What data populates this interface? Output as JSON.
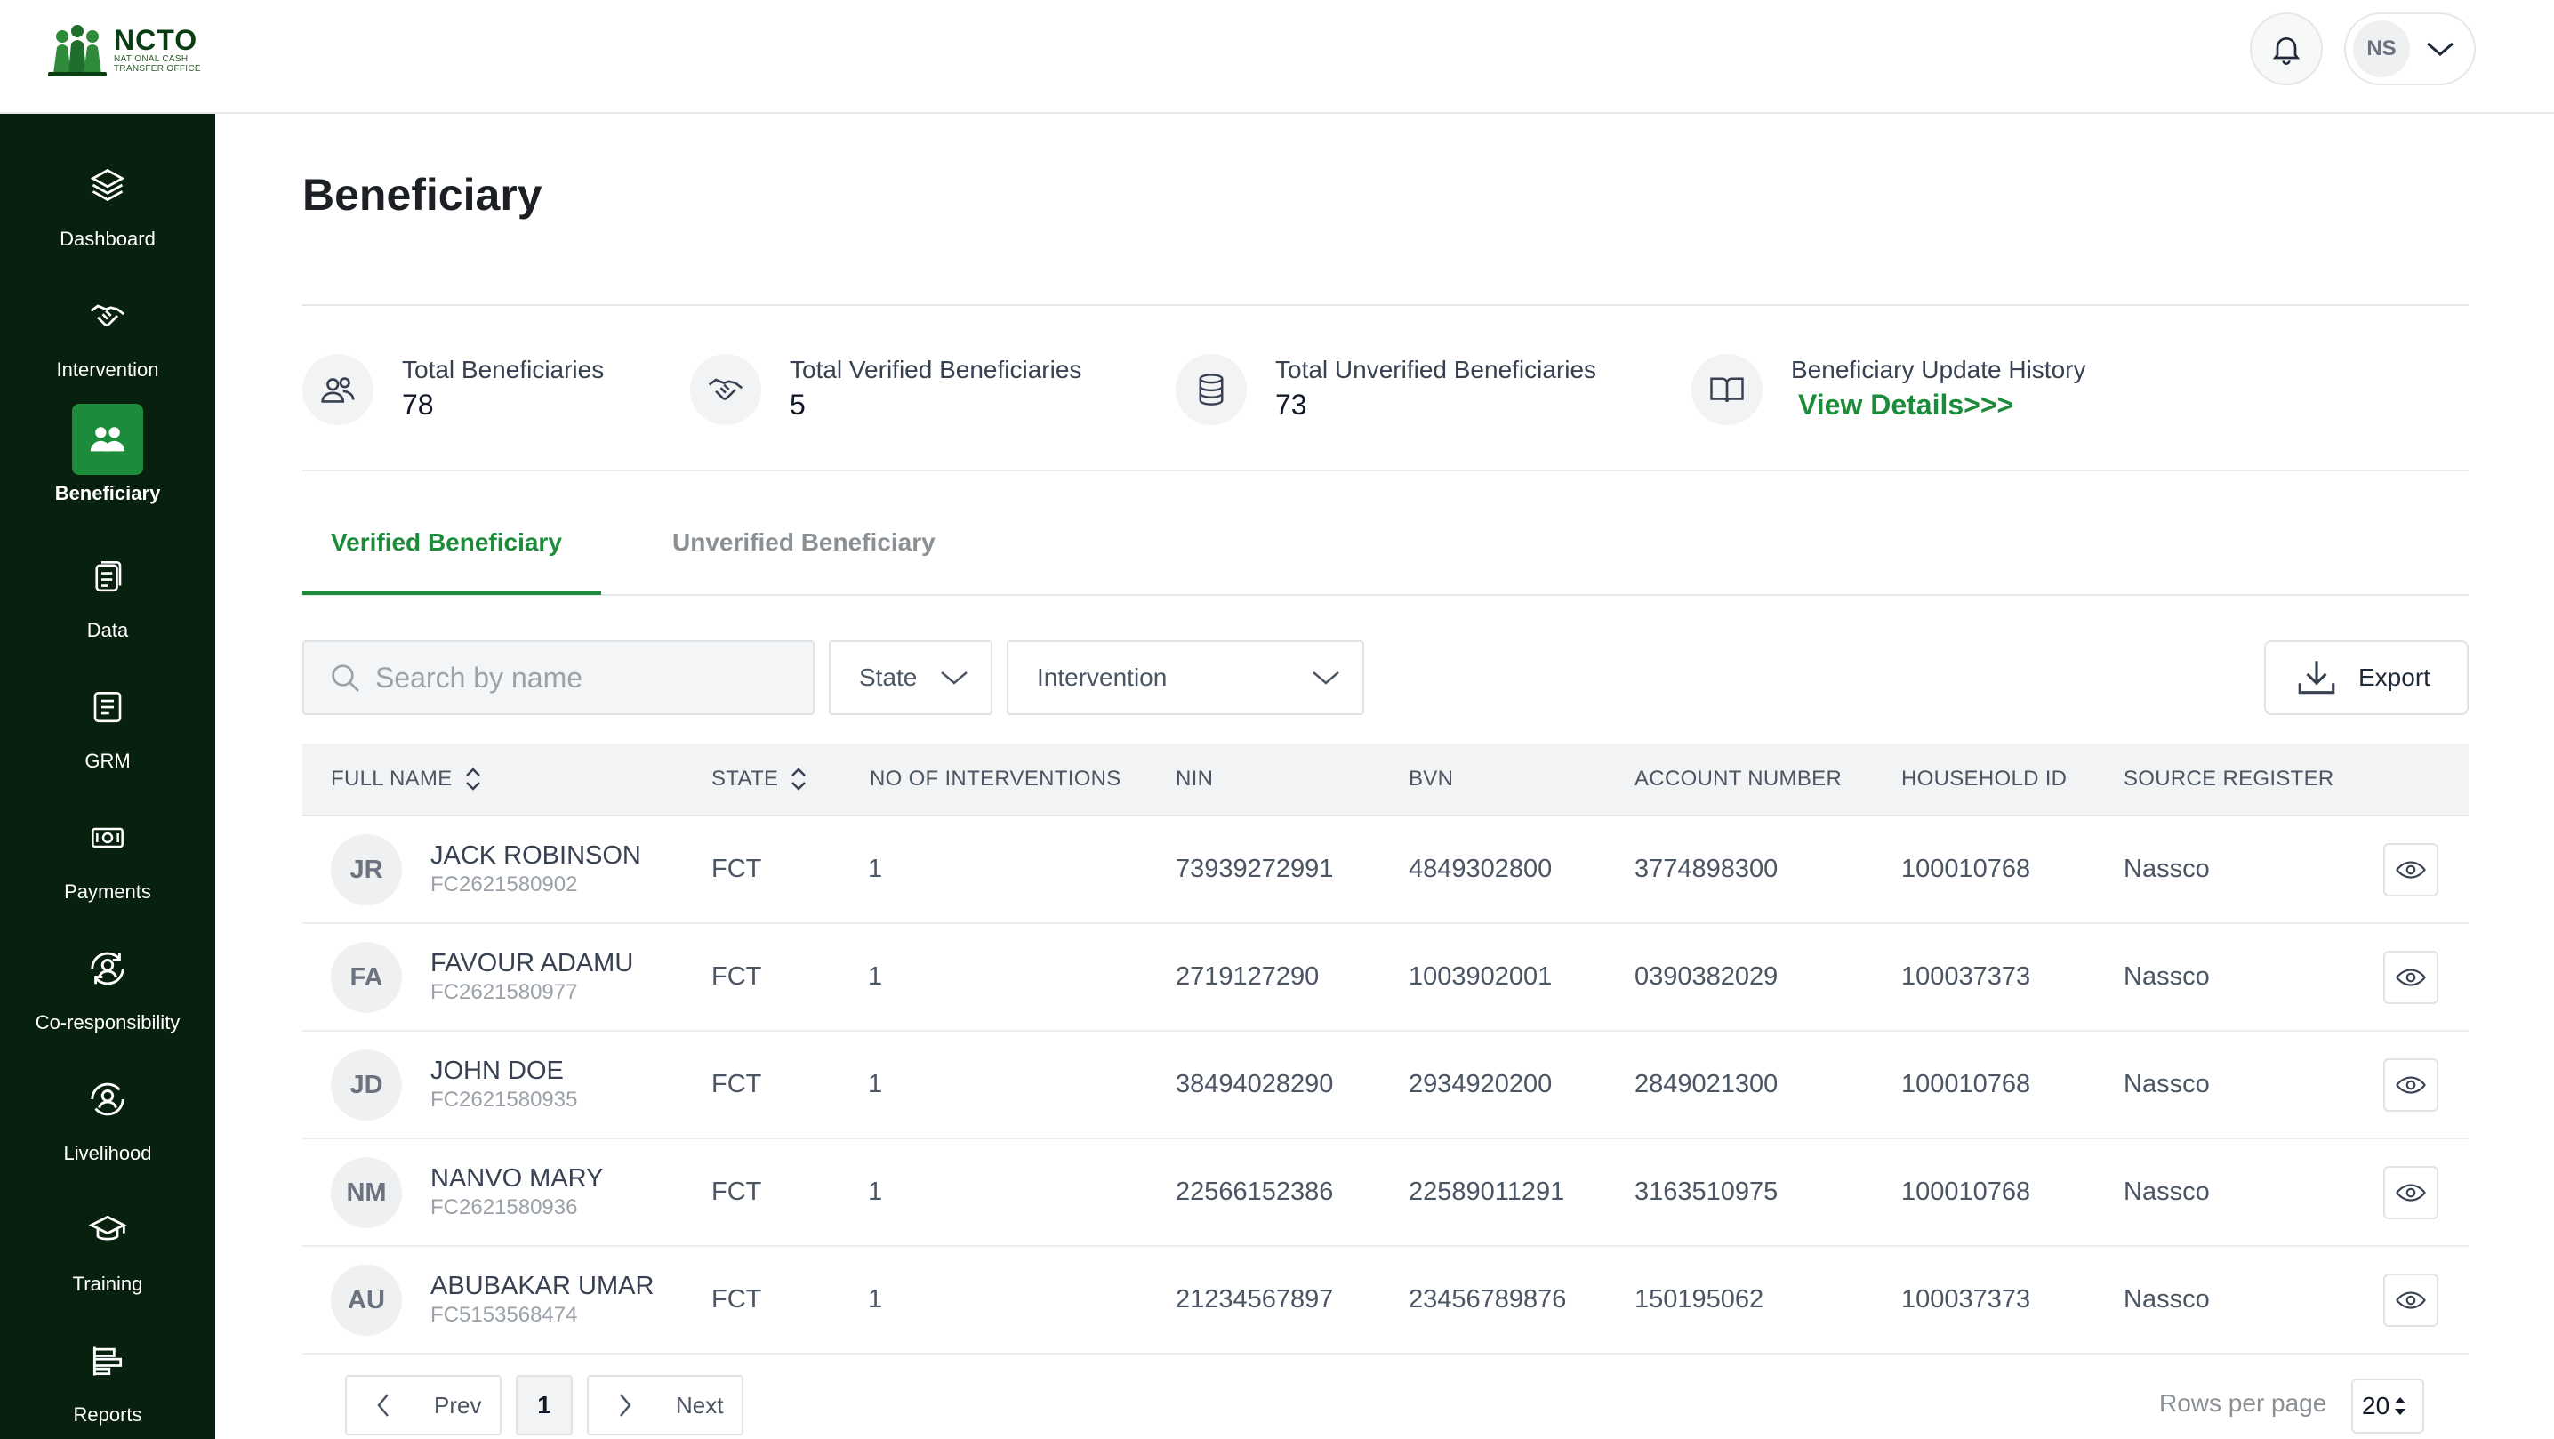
{
  "brand": {
    "title": "NCTO",
    "subtitle_line1": "NATIONAL CASH",
    "subtitle_line2": "TRANSFER OFFICE"
  },
  "header": {
    "user_initials": "NS"
  },
  "sidebar": {
    "items": [
      {
        "label": "Dashboard",
        "icon": "layers-icon"
      },
      {
        "label": "Intervention",
        "icon": "handshake-icon"
      },
      {
        "label": "Beneficiary",
        "icon": "users-icon",
        "active": true
      },
      {
        "label": "Data",
        "icon": "document-icon"
      },
      {
        "label": "GRM",
        "icon": "note-icon"
      },
      {
        "label": "Payments",
        "icon": "cash-icon"
      },
      {
        "label": "Co-responsibility",
        "icon": "user-refresh-icon"
      },
      {
        "label": "Livelihood",
        "icon": "user-cycle-icon"
      },
      {
        "label": "Training",
        "icon": "graduation-cap-icon"
      },
      {
        "label": "Reports",
        "icon": "bar-chart-icon"
      }
    ]
  },
  "page": {
    "title": "Beneficiary"
  },
  "stats": [
    {
      "label": "Total Beneficiaries",
      "value": "78",
      "icon": "users-icon"
    },
    {
      "label": "Total Verified Beneficiaries",
      "value": "5",
      "icon": "handshake-icon"
    },
    {
      "label": "Total Unverified Beneficiaries",
      "value": "73",
      "icon": "database-icon"
    },
    {
      "label": "Beneficiary Update History",
      "link": "View Details>>>",
      "icon": "book-icon"
    }
  ],
  "tabs": {
    "active": "Verified Beneficiary",
    "inactive": "Unverified Beneficiary"
  },
  "filters": {
    "search_placeholder": "Search by name",
    "state": "State",
    "intervention": "Intervention",
    "export": "Export"
  },
  "table": {
    "headers": {
      "full_name": "FULL NAME",
      "state": "STATE",
      "interventions": "NO OF INTERVENTIONS",
      "nin": "NIN",
      "bvn": "BVN",
      "account": "ACCOUNT NUMBER",
      "household": "HOUSEHOLD ID",
      "source": "SOURCE REGISTER"
    },
    "rows": [
      {
        "initials": "JR",
        "name": "JACK ROBINSON",
        "code": "FC2621580902",
        "state": "FCT",
        "interventions": "1",
        "nin": "73939272991",
        "bvn": "4849302800",
        "account": "3774898300",
        "household": "100010768",
        "source": "Nassco"
      },
      {
        "initials": "FA",
        "name": "FAVOUR ADAMU",
        "code": "FC2621580977",
        "state": "FCT",
        "interventions": "1",
        "nin": "2719127290",
        "bvn": "1003902001",
        "account": "0390382029",
        "household": "100037373",
        "source": "Nassco"
      },
      {
        "initials": "JD",
        "name": "JOHN DOE",
        "code": "FC2621580935",
        "state": "FCT",
        "interventions": "1",
        "nin": "38494028290",
        "bvn": "2934920200",
        "account": "2849021300",
        "household": "100010768",
        "source": "Nassco"
      },
      {
        "initials": "NM",
        "name": "NANVO MARY",
        "code": "FC2621580936",
        "state": "FCT",
        "interventions": "1",
        "nin": "22566152386",
        "bvn": "22589011291",
        "account": "3163510975",
        "household": "100010768",
        "source": "Nassco"
      },
      {
        "initials": "AU",
        "name": "ABUBAKAR UMAR",
        "code": "FC5153568474",
        "state": "FCT",
        "interventions": "1",
        "nin": "21234567897",
        "bvn": "23456789876",
        "account": "150195062",
        "household": "100037373",
        "source": "Nassco"
      }
    ]
  },
  "pagination": {
    "prev": "Prev",
    "page": "1",
    "next": "Next",
    "rows_label": "Rows per page",
    "rows_value": "20"
  },
  "colors": {
    "sidebar_bg": "#08210e",
    "accent": "#1d8c3a"
  }
}
